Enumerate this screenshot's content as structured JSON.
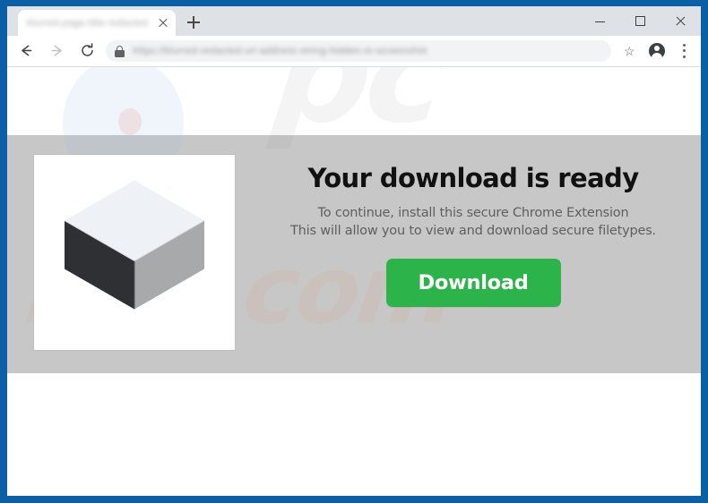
{
  "browser": {
    "tab": {
      "title": "blurred-page-title-redacted",
      "close_label": "×"
    },
    "new_tab_label": "+",
    "window_controls": {
      "minimize": "−",
      "maximize": "▫",
      "close": "✕"
    },
    "toolbar": {
      "back_label": "Back",
      "forward_label": "Forward",
      "reload_label": "Reload",
      "url": "https://blurred-redacted-url-address-string-hidden-in-screenshot",
      "bookmark_label": "★",
      "profile_label": "Profile",
      "menu_label": "⋮"
    }
  },
  "page": {
    "headline": "Your download is ready",
    "subline_1": "To continue, install this secure Chrome Extension",
    "subline_2": "This will allow you to view and download secure filetypes.",
    "download_button": "Download",
    "watermark_top": "pc",
    "watermark_bottom": "risk.com",
    "colors": {
      "window_frame": "#0b5fa5",
      "band": "#c7c7c7",
      "button_green": "#2cb34a",
      "headline": "#111111",
      "subline": "#5d5f60",
      "cube_top": "#eef1f5",
      "cube_left": "#2e3033",
      "cube_right": "#a8a9ab"
    }
  }
}
